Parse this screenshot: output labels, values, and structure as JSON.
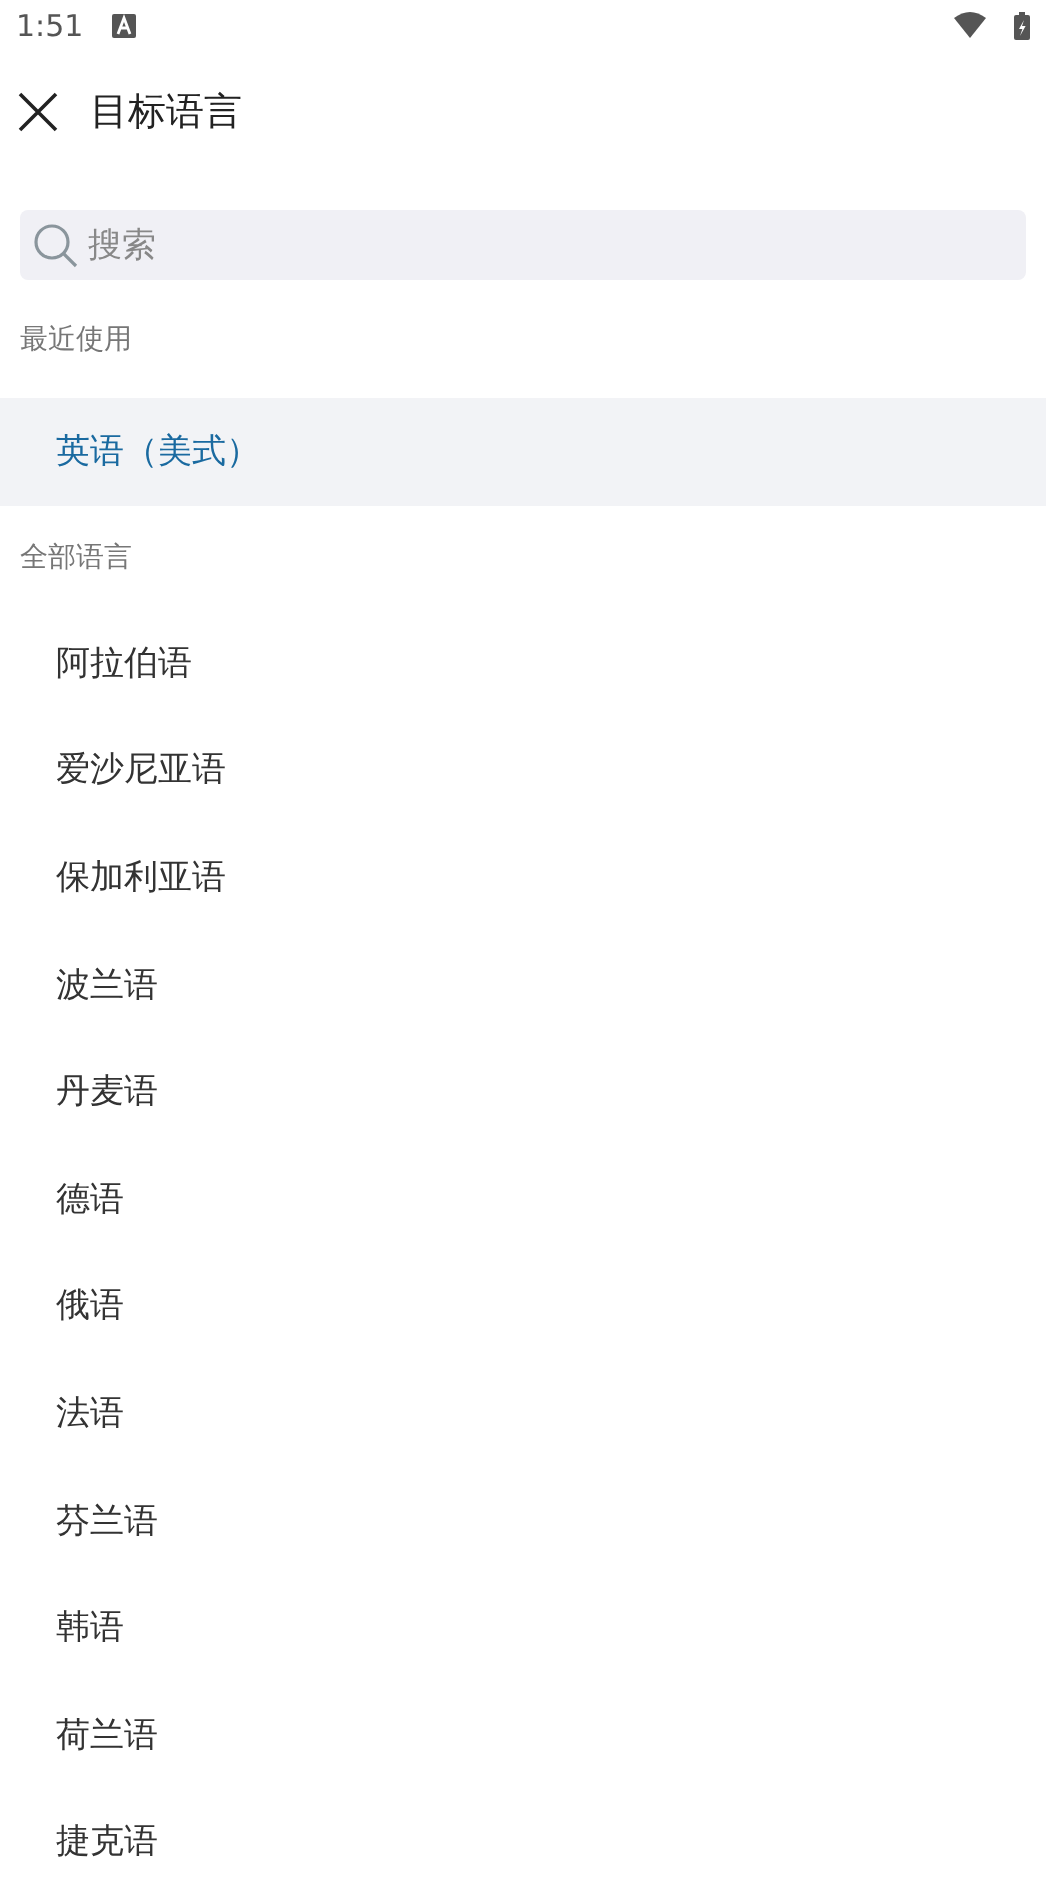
{
  "status_bar": {
    "time": "1:51"
  },
  "header": {
    "title": "目标语言"
  },
  "search": {
    "placeholder": "搜索"
  },
  "sections": [
    {
      "title": "最近使用",
      "items": [
        {
          "label": "英语（美式）",
          "selected": true
        }
      ]
    },
    {
      "title": "全部语言",
      "items": [
        {
          "label": "阿拉伯语",
          "selected": false
        },
        {
          "label": "爱沙尼亚语",
          "selected": false
        },
        {
          "label": "保加利亚语",
          "selected": false
        },
        {
          "label": "波兰语",
          "selected": false
        },
        {
          "label": "丹麦语",
          "selected": false
        },
        {
          "label": "德语",
          "selected": false
        },
        {
          "label": "俄语",
          "selected": false
        },
        {
          "label": "法语",
          "selected": false
        },
        {
          "label": "芬兰语",
          "selected": false
        },
        {
          "label": "韩语",
          "selected": false
        },
        {
          "label": "荷兰语",
          "selected": false
        },
        {
          "label": "捷克语",
          "selected": false
        }
      ]
    }
  ]
}
